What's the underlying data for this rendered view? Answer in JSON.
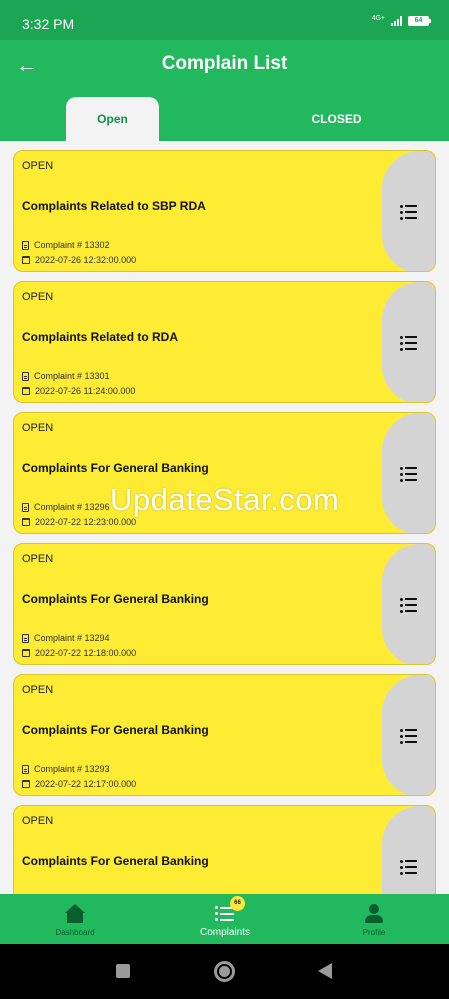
{
  "status_bar": {
    "time": "3:32 PM",
    "network": "4G+",
    "battery": "64"
  },
  "app_bar": {
    "title": "Complain List",
    "back_icon": "arrow-left-icon"
  },
  "tabs": [
    {
      "label": "Open",
      "selected": true
    },
    {
      "label": "CLOSED",
      "selected": false
    }
  ],
  "complaints": [
    {
      "status": "OPEN",
      "title": "Complaints Related to SBP RDA",
      "number": "Complaint # 13302",
      "date": "2022-07-26 12:32:00.000"
    },
    {
      "status": "OPEN",
      "title": "Complaints Related to RDA",
      "number": "Complaint # 13301",
      "date": "2022-07-26 11:24:00.000"
    },
    {
      "status": "OPEN",
      "title": "Complaints For General Banking",
      "number": "Complaint # 13296",
      "date": "2022-07-22 12:23:00.000"
    },
    {
      "status": "OPEN",
      "title": "Complaints For General Banking",
      "number": "Complaint # 13294",
      "date": "2022-07-22 12:18:00.000"
    },
    {
      "status": "OPEN",
      "title": "Complaints For General Banking",
      "number": "Complaint # 13293",
      "date": "2022-07-22 12:17:00.000"
    },
    {
      "status": "OPEN",
      "title": "Complaints For General Banking",
      "number": "",
      "date": ""
    }
  ],
  "watermark": "UpdateStar.com",
  "bottom_nav": {
    "dashboard": {
      "label": "Dashboard",
      "icon": "home-icon"
    },
    "complaints": {
      "label": "Complaints",
      "icon": "list-icon",
      "badge": "66"
    },
    "profile": {
      "label": "Profile",
      "icon": "person-icon"
    }
  },
  "colors": {
    "primary": "#22b85e",
    "status_bar": "#1aa652",
    "card": "#fdeb34",
    "menu_panel": "#d4d4d4",
    "badge": "#fde73a"
  }
}
